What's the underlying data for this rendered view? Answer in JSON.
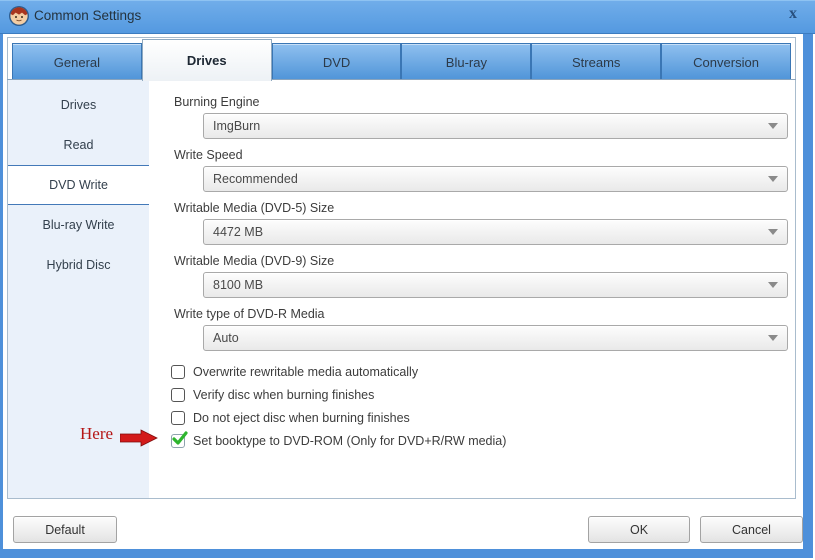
{
  "window": {
    "title": "Common Settings",
    "close_glyph": "x"
  },
  "tabs": [
    {
      "label": "General",
      "selected": false
    },
    {
      "label": "Drives",
      "selected": true
    },
    {
      "label": "DVD",
      "selected": false
    },
    {
      "label": "Blu-ray",
      "selected": false
    },
    {
      "label": "Streams",
      "selected": false
    },
    {
      "label": "Conversion",
      "selected": false
    }
  ],
  "sidebar": {
    "items": [
      {
        "label": "Drives",
        "selected": false
      },
      {
        "label": "Read",
        "selected": false
      },
      {
        "label": "DVD Write",
        "selected": true
      },
      {
        "label": "Blu-ray Write",
        "selected": false
      },
      {
        "label": "Hybrid Disc",
        "selected": false
      }
    ]
  },
  "content": {
    "fields": [
      {
        "label": "Burning Engine",
        "value": "ImgBurn"
      },
      {
        "label": "Write Speed",
        "value": "Recommended"
      },
      {
        "label": "Writable Media (DVD-5) Size",
        "value": "4472 MB"
      },
      {
        "label": "Writable Media (DVD-9) Size",
        "value": "8100 MB"
      },
      {
        "label": "Write type of DVD-R Media",
        "value": "Auto"
      }
    ],
    "checkboxes": [
      {
        "label": "Overwrite rewritable media automatically",
        "checked": false
      },
      {
        "label": "Verify disc when burning finishes",
        "checked": false
      },
      {
        "label": "Do not eject disc when burning finishes",
        "checked": false
      },
      {
        "label": "Set booktype to DVD-ROM (Only for DVD+R/RW media)",
        "checked": true
      }
    ]
  },
  "annotation": {
    "label": "Here",
    "arrow_icon": "arrow-right-icon"
  },
  "footer": {
    "default_label": "Default",
    "ok_label": "OK",
    "cancel_label": "Cancel"
  },
  "colors": {
    "titlebar_blue": "#5e9fe3",
    "tab_blue": "#5f9fdd",
    "tab_border_blue": "#3a76b4",
    "frame_blue": "#4e90da",
    "sidebar_bg": "#eaf1fa",
    "check_green": "#2eb52e",
    "annotation_red": "#c21414"
  }
}
